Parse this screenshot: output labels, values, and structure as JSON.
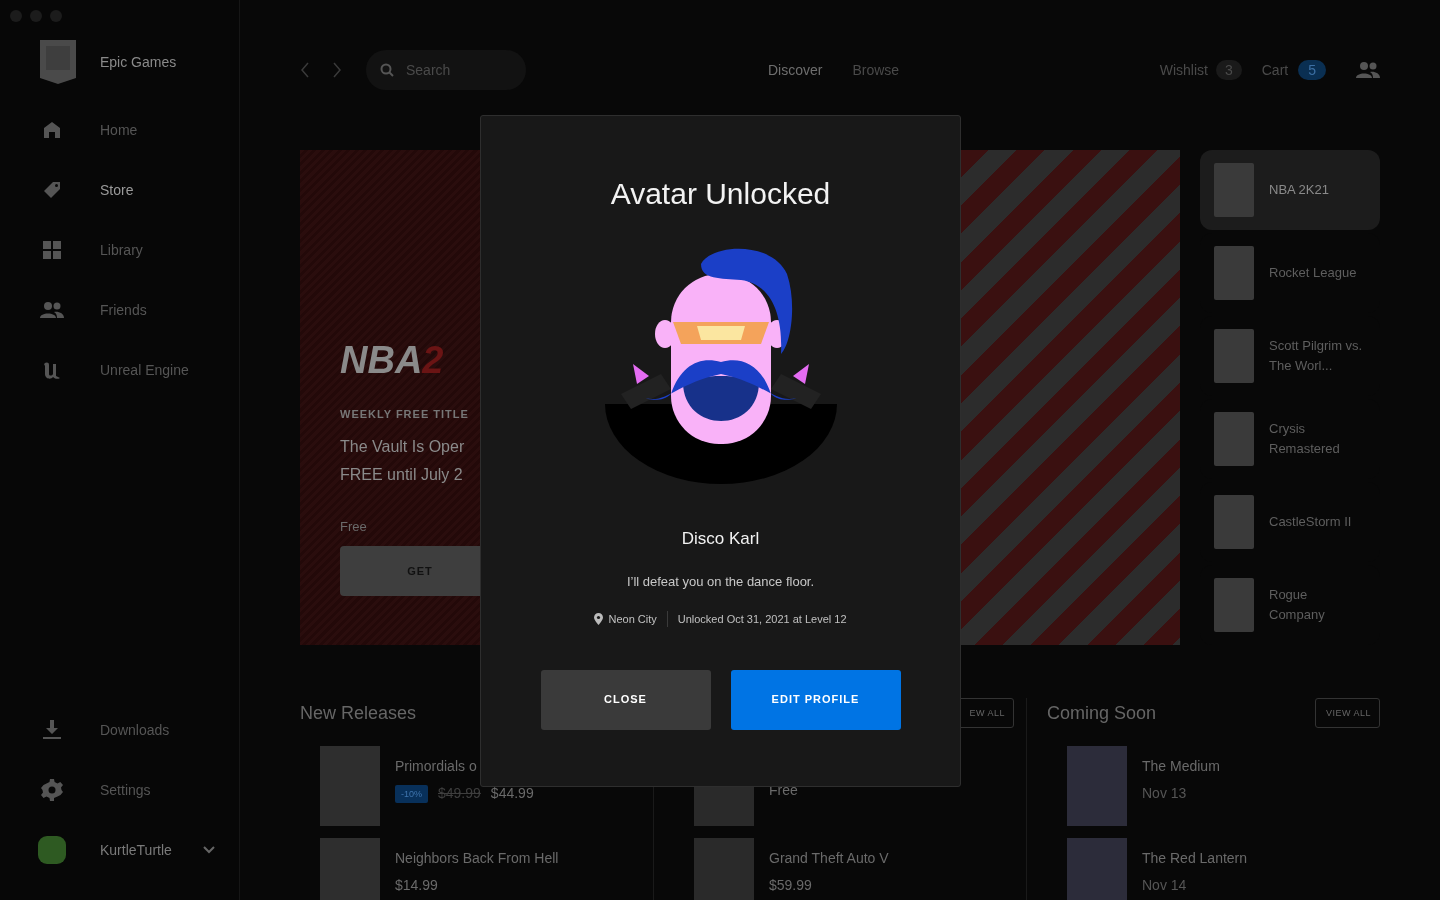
{
  "sidebar": {
    "brand": "Epic Games",
    "items": [
      {
        "label": "Home",
        "selected": false
      },
      {
        "label": "Store",
        "selected": true
      },
      {
        "label": "Library",
        "selected": false
      },
      {
        "label": "Friends",
        "selected": false
      },
      {
        "label": "Unreal Engine",
        "selected": false
      }
    ],
    "bottom_items": [
      {
        "label": "Downloads"
      },
      {
        "label": "Settings"
      }
    ],
    "user": {
      "name": "KurtleTurtle"
    }
  },
  "topbar": {
    "search": {
      "placeholder": "Search"
    },
    "nav": [
      {
        "label": "Discover",
        "selected": true
      },
      {
        "label": "Browse",
        "selected": false
      }
    ],
    "wishlist": {
      "label": "Wishlist",
      "count": "3"
    },
    "cart": {
      "label": "Cart",
      "count": "5"
    }
  },
  "hero": {
    "logo": "NBA",
    "logo_accent": "2",
    "eyebrow": "WEEKLY FREE TITLE",
    "title_lines": [
      "The Vault Is Oper",
      "FREE until July 2"
    ],
    "price": "Free",
    "button": "GET"
  },
  "featured": [
    {
      "title": "NBA 2K21",
      "selected": true
    },
    {
      "title": "Rocket League",
      "selected": false
    },
    {
      "title": "Scott Pilgrim vs. The Worl...",
      "selected": false
    },
    {
      "title": "Crysis Remastered",
      "selected": false
    },
    {
      "title": "CastleStorm II",
      "selected": false
    },
    {
      "title": "Rogue Company",
      "selected": false
    }
  ],
  "new_releases": {
    "title": "New Releases",
    "items": [
      {
        "title": "Primordials o",
        "discount": "-10%",
        "original_price": "$49.99",
        "price": "$44.99"
      },
      {
        "title": "Neighbors Back From Hell",
        "price": "$14.99"
      }
    ]
  },
  "middle_section": {
    "view_all": "EW ALL",
    "items": [
      {
        "price": "Free"
      },
      {
        "title": "Grand Theft Auto V",
        "price": "$59.99"
      }
    ]
  },
  "coming_soon": {
    "title": "Coming Soon",
    "view_all": "VIEW ALL",
    "items": [
      {
        "title": "The Medium",
        "date": "Nov 13"
      },
      {
        "title": "The Red Lantern",
        "date": "Nov 14"
      }
    ]
  },
  "modal": {
    "title": "Avatar Unlocked",
    "name": "Disco Karl",
    "quote": "I’ll defeat you on the dance floor.",
    "location": "Neon City",
    "unlocked": "Unlocked Oct 31, 2021 at Level 12",
    "buttons": [
      {
        "label": "CLOSE",
        "kind": "secondary"
      },
      {
        "label": "EDIT PROFILE",
        "kind": "primary"
      }
    ]
  }
}
